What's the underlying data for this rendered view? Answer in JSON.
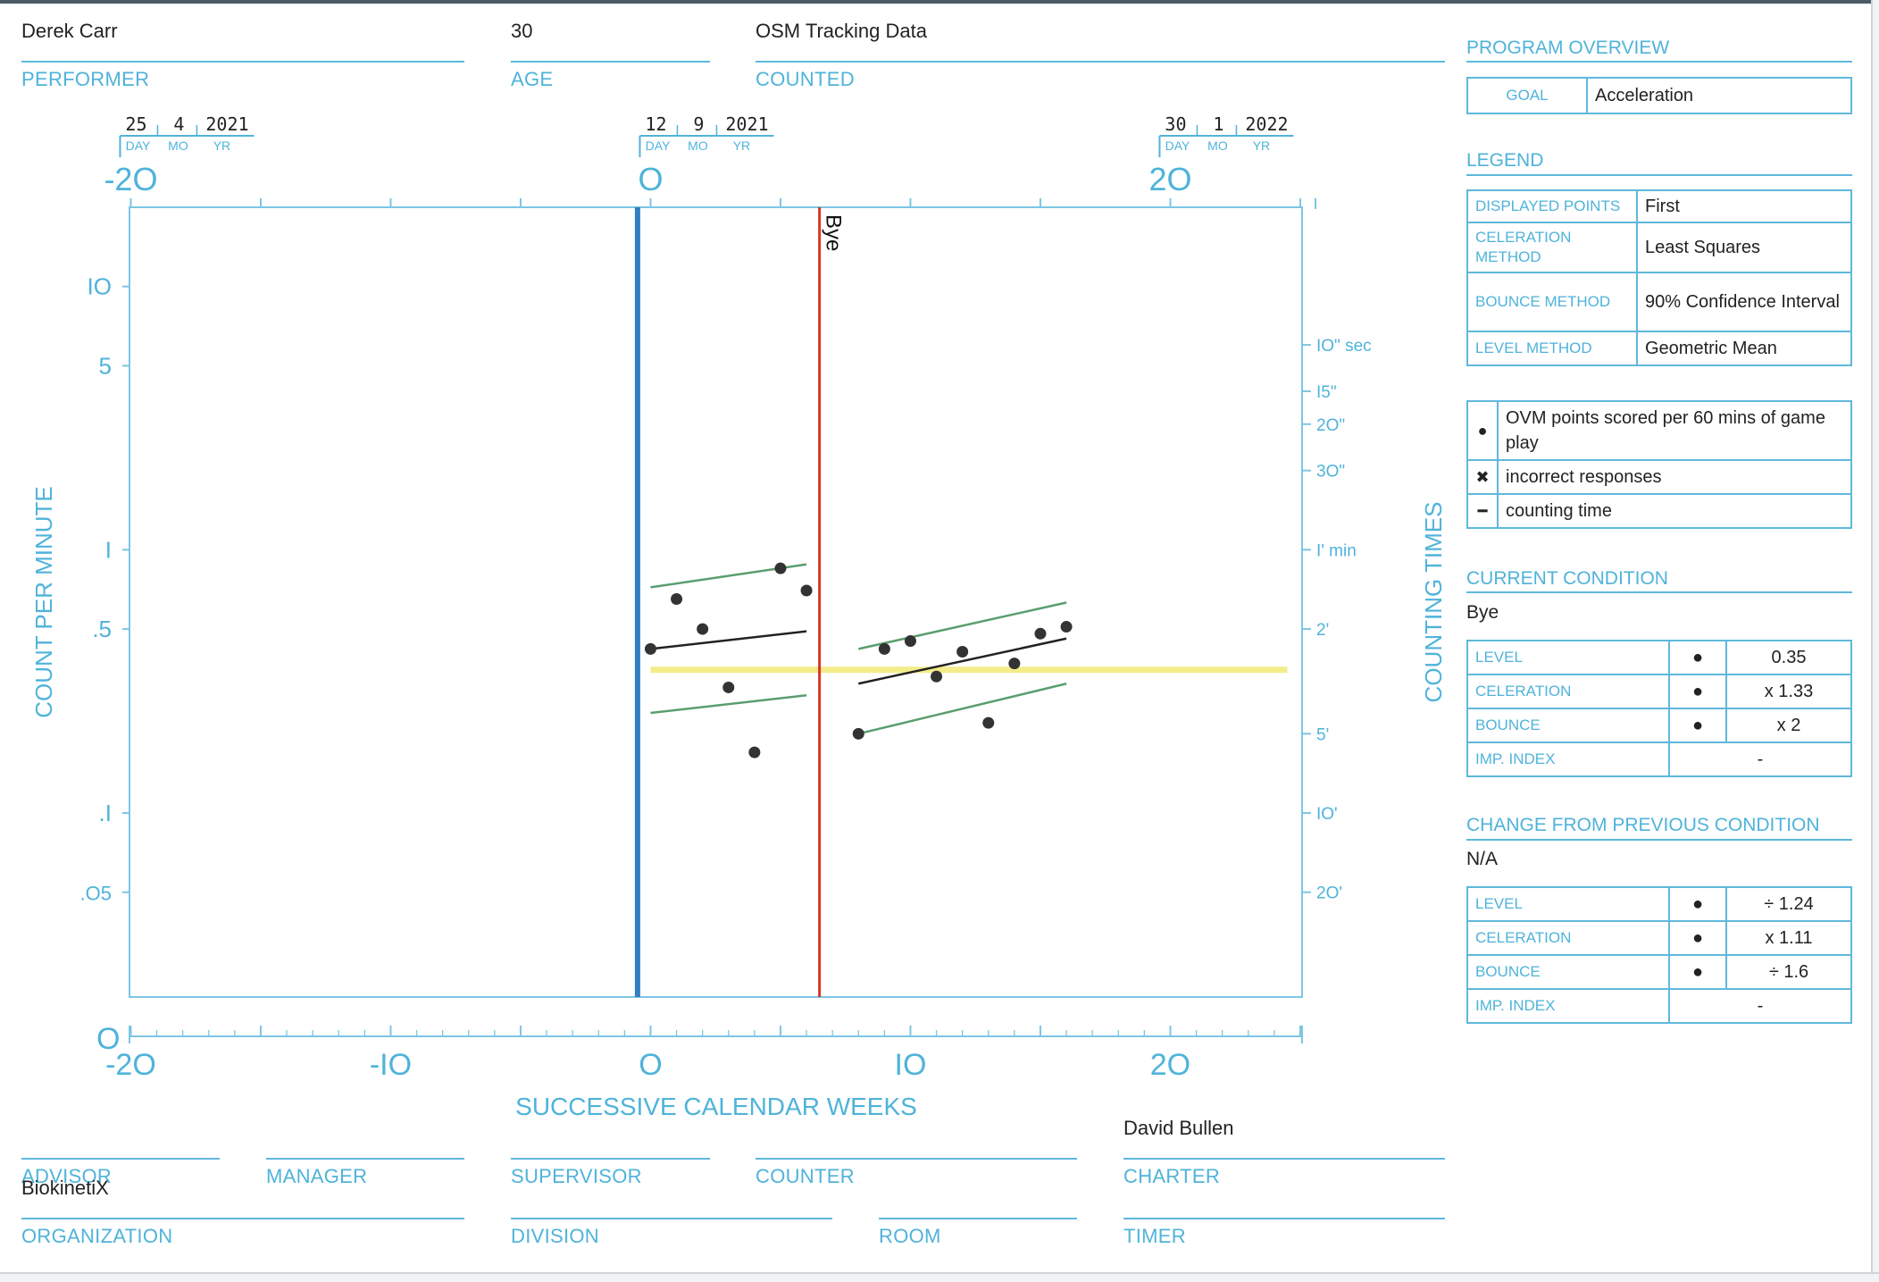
{
  "header": {
    "performer": {
      "value": "Derek Carr",
      "label": "PERFORMER"
    },
    "age": {
      "value": "30",
      "label": "AGE"
    },
    "counted": {
      "value": "OSM Tracking Data",
      "label": "COUNTED"
    }
  },
  "footer": {
    "advisor": {
      "label": "ADVISOR",
      "value": ""
    },
    "manager": {
      "label": "MANAGER",
      "value": ""
    },
    "supervisor": {
      "label": "SUPERVISOR",
      "value": ""
    },
    "counter": {
      "label": "COUNTER",
      "value": ""
    },
    "charter": {
      "label": "CHARTER",
      "value": "David Bullen"
    },
    "organization": {
      "label": "ORGANIZATION",
      "value": "BiokinetiX"
    },
    "division": {
      "label": "DIVISION",
      "value": ""
    },
    "room": {
      "label": "ROOM",
      "value": ""
    },
    "timer": {
      "label": "TIMER",
      "value": ""
    }
  },
  "program_overview": {
    "title": "PROGRAM OVERVIEW",
    "goal_label": "GOAL",
    "goal_value": "Acceleration"
  },
  "legend": {
    "title": "LEGEND",
    "rows": [
      {
        "label": "DISPLAYED POINTS",
        "value": "First"
      },
      {
        "label": "CELERATION METHOD",
        "value": "Least Squares"
      },
      {
        "label": "BOUNCE METHOD",
        "value": "90% Confidence Interval"
      },
      {
        "label": "LEVEL METHOD",
        "value": "Geometric Mean"
      }
    ],
    "symbols": [
      {
        "symbol": "●",
        "text": "OVM points scored per 60 mins of game play"
      },
      {
        "symbol": "✖",
        "text": "incorrect responses"
      },
      {
        "symbol": "━",
        "text": "counting time"
      }
    ]
  },
  "current_condition": {
    "title": "CURRENT CONDITION",
    "name": "Bye",
    "rows": [
      {
        "label": "LEVEL",
        "symbol": "●",
        "value": "0.35"
      },
      {
        "label": "CELERATION",
        "symbol": "●",
        "value": "x 1.33"
      },
      {
        "label": "BOUNCE",
        "symbol": "●",
        "value": "x 2"
      },
      {
        "label": "IMP. INDEX",
        "symbol": "",
        "value": "-"
      }
    ]
  },
  "change_condition": {
    "title": "CHANGE FROM PREVIOUS CONDITION",
    "name": "N/A",
    "rows": [
      {
        "label": "LEVEL",
        "symbol": "●",
        "value": "÷ 1.24"
      },
      {
        "label": "CELERATION",
        "symbol": "●",
        "value": "x 1.11"
      },
      {
        "label": "BOUNCE",
        "symbol": "●",
        "value": "÷ 1.6"
      },
      {
        "label": "IMP. INDEX",
        "symbol": "",
        "value": "-"
      }
    ]
  },
  "colors": {
    "accent": "#4fb3da",
    "phase_line": "#d9342b",
    "start_line": "#2f7fc1",
    "celeration": "#222222",
    "bounce": "#5a9e6f",
    "level": "#f3ec8a",
    "points": "#333333"
  },
  "chart_data": {
    "type": "scatter",
    "xlabel": "SUCCESSIVE CALENDAR WEEKS",
    "ylabel": "COUNT PER MINUTE",
    "right_label": "COUNTING TIMES",
    "scale": "log",
    "xlim": [
      -20,
      25
    ],
    "ylim": [
      0.02,
      20
    ],
    "x_ticks": [
      "-2O",
      "-IO",
      "O",
      "IO",
      "2O"
    ],
    "x_tick_values": [
      -20,
      -10,
      0,
      10,
      20
    ],
    "top_ticks": [
      "-2O",
      "O",
      "2O"
    ],
    "top_tick_values": [
      -20,
      0,
      20
    ],
    "zero_label": "O",
    "y_ticks": [
      {
        "label": "IO",
        "value": 10
      },
      {
        "label": "5",
        "value": 5
      },
      {
        "label": "I",
        "value": 1
      },
      {
        "label": ".5",
        "value": 0.5
      },
      {
        "label": ".I",
        "value": 0.1
      },
      {
        "label": ".O5",
        "value": 0.05
      }
    ],
    "right_ticks": [
      {
        "label": "IO\" sec",
        "value": 6
      },
      {
        "label": "I5\"",
        "value": 4
      },
      {
        "label": "2O\"",
        "value": 3
      },
      {
        "label": "3O\"",
        "value": 2
      },
      {
        "label": "I' min",
        "value": 1
      },
      {
        "label": "2'",
        "value": 0.5
      },
      {
        "label": "5'",
        "value": 0.2
      },
      {
        "label": "IO'",
        "value": 0.1
      },
      {
        "label": "2O'",
        "value": 0.05
      }
    ],
    "dates": [
      {
        "day": "25",
        "mo": "4",
        "yr": "2021",
        "week": -20
      },
      {
        "day": "12",
        "mo": "9",
        "yr": "2021",
        "week": 0
      },
      {
        "day": "30",
        "mo": "1",
        "yr": "2022",
        "week": 20
      }
    ],
    "date_labels": {
      "day": "DAY",
      "mo": "MO",
      "yr": "YR"
    },
    "start_line_week": -0.5,
    "phase_line": {
      "week": 6.5,
      "label": "Bye"
    },
    "points": [
      {
        "x": 0,
        "y": 0.42
      },
      {
        "x": 1,
        "y": 0.65
      },
      {
        "x": 2,
        "y": 0.5
      },
      {
        "x": 3,
        "y": 0.3
      },
      {
        "x": 4,
        "y": 0.17
      },
      {
        "x": 5,
        "y": 0.85
      },
      {
        "x": 6,
        "y": 0.7
      },
      {
        "x": 8,
        "y": 0.2
      },
      {
        "x": 9,
        "y": 0.42
      },
      {
        "x": 10,
        "y": 0.45
      },
      {
        "x": 11,
        "y": 0.33
      },
      {
        "x": 12,
        "y": 0.41
      },
      {
        "x": 13,
        "y": 0.22
      },
      {
        "x": 14,
        "y": 0.37
      },
      {
        "x": 15,
        "y": 0.48
      },
      {
        "x": 16,
        "y": 0.51
      }
    ],
    "celeration_lines": [
      {
        "x1": 0,
        "y1": 0.42,
        "x2": 6,
        "y2": 0.49
      },
      {
        "x1": 8,
        "y1": 0.31,
        "x2": 16,
        "y2": 0.46
      }
    ],
    "bounce_lines": [
      {
        "x1": 0,
        "y1": 0.72,
        "x2": 6,
        "y2": 0.88
      },
      {
        "x1": 0,
        "y1": 0.24,
        "x2": 6,
        "y2": 0.28
      },
      {
        "x1": 8,
        "y1": 0.42,
        "x2": 16,
        "y2": 0.63
      },
      {
        "x1": 8,
        "y1": 0.2,
        "x2": 16,
        "y2": 0.31
      }
    ],
    "level_line": {
      "x1": 0,
      "x2": 24.5,
      "y": 0.35
    }
  }
}
